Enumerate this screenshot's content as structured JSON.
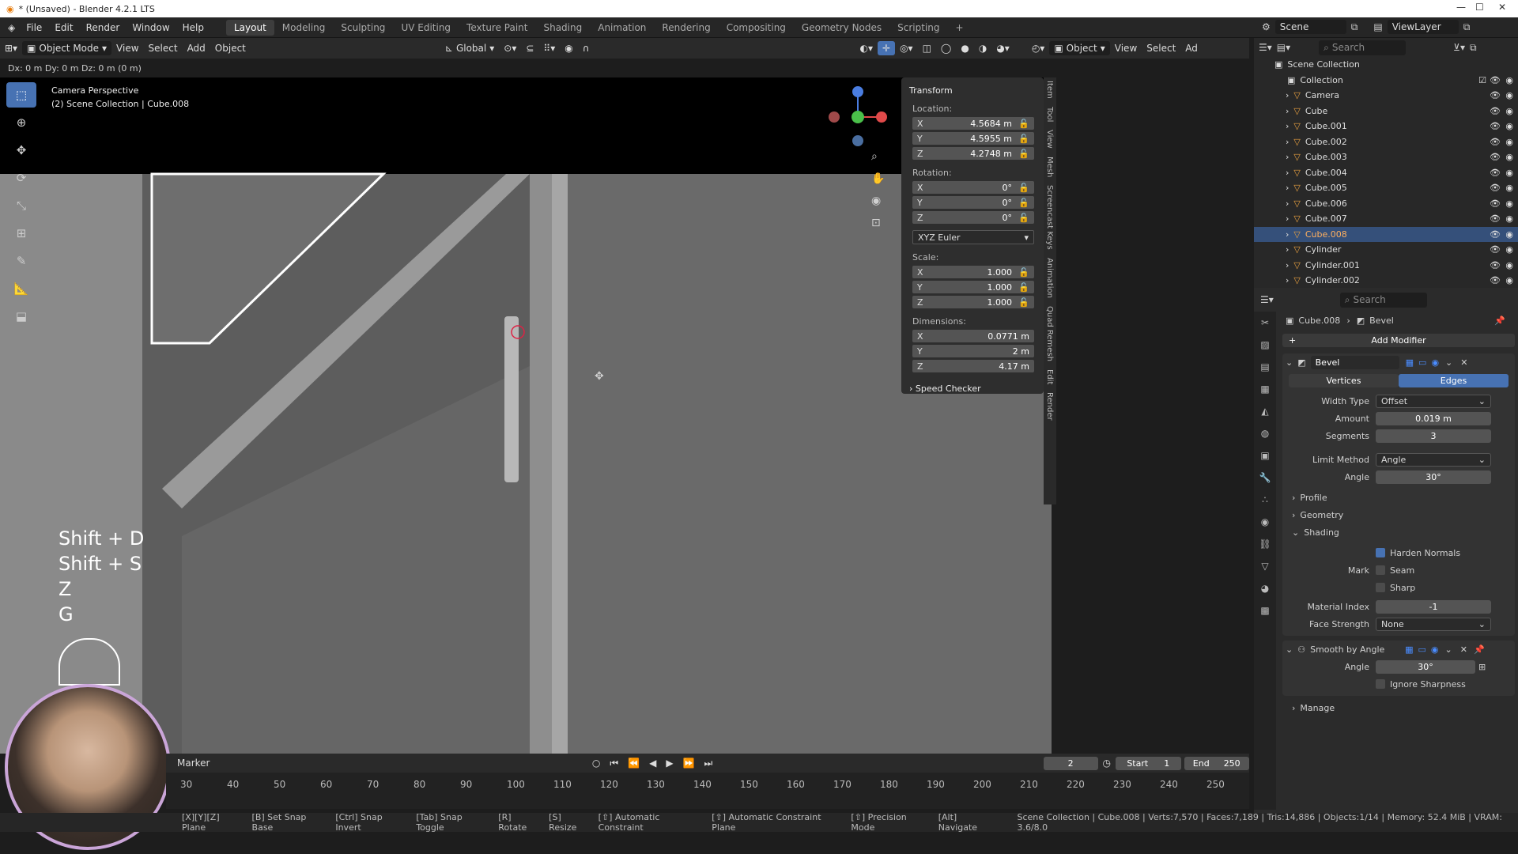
{
  "window": {
    "title": "* (Unsaved) - Blender 4.2.1 LTS"
  },
  "menu": [
    "File",
    "Edit",
    "Render",
    "Window",
    "Help"
  ],
  "workspaces": [
    "Layout",
    "Modeling",
    "Sculpting",
    "UV Editing",
    "Texture Paint",
    "Shading",
    "Animation",
    "Rendering",
    "Compositing",
    "Geometry Nodes",
    "Scripting"
  ],
  "active_workspace": "Layout",
  "scene": {
    "name": "Scene",
    "view_layer": "ViewLayer"
  },
  "header": {
    "mode": "Object Mode",
    "view": "View",
    "select": "Select",
    "add": "Add",
    "object": "Object",
    "orientation": "Global",
    "right_object": "Object",
    "right_view": "View",
    "right_select": "Select",
    "right_ad": "Ad"
  },
  "info": "Dx: 0 m   Dy: 0 m   Dz: 0 m (0 m)",
  "viewport": {
    "line1": "Camera Perspective",
    "line2": "(2) Scene Collection | Cube.008"
  },
  "keys": [
    "Shift + D",
    "Shift + S",
    "Z",
    "G"
  ],
  "transform": {
    "title": "Transform",
    "location_label": "Location:",
    "location": [
      "4.5684 m",
      "4.5955 m",
      "4.2748 m"
    ],
    "rotation_label": "Rotation:",
    "rotation": [
      "0°",
      "0°",
      "0°"
    ],
    "euler": "XYZ Euler",
    "scale_label": "Scale:",
    "scale": [
      "1.000",
      "1.000",
      "1.000"
    ],
    "dimensions_label": "Dimensions:",
    "dimensions": [
      "0.0771 m",
      "2 m",
      "4.17 m"
    ],
    "speed_checker": "Speed Checker",
    "axes": [
      "X",
      "Y",
      "Z"
    ]
  },
  "side_tabs": [
    "Item",
    "Tool",
    "View",
    "Mesh",
    "Screencast Keys",
    "Animation",
    "Quad Remesh",
    "Edit",
    "Render"
  ],
  "timeline": {
    "marker": "Marker",
    "current": "2",
    "start_label": "Start",
    "start": "1",
    "end_label": "End",
    "end": "250",
    "ticks": [
      "30",
      "40",
      "50",
      "60",
      "70",
      "80",
      "90",
      "100",
      "110",
      "120",
      "130",
      "140",
      "150",
      "160",
      "170",
      "180",
      "190",
      "200",
      "210",
      "220",
      "230",
      "240",
      "250"
    ]
  },
  "status": [
    "Plane",
    "Set Snap Base",
    "Snap Invert",
    "Snap Toggle",
    "Rotate",
    "Resize",
    "Automatic Constraint",
    "Automatic Constraint Plane",
    "Precision Mode",
    "Navigate"
  ],
  "status_keys": [
    "X",
    "Y",
    "Z",
    "B",
    "Ctrl",
    "Tab",
    "R",
    "S",
    "⇧",
    "⇧",
    "⇧",
    "Alt"
  ],
  "stats": "Scene Collection | Cube.008 | Verts:7,570 | Faces:7,189 | Tris:14,886 | Objects:1/14 | Memory: 52.4 MiB | VRAM: 3.6/8.0",
  "outliner": {
    "search": "Search",
    "root": "Scene Collection",
    "collection": "Collection",
    "items": [
      "Camera",
      "Cube",
      "Cube.001",
      "Cube.002",
      "Cube.003",
      "Cube.004",
      "Cube.005",
      "Cube.006",
      "Cube.007",
      "Cube.008",
      "Cylinder",
      "Cylinder.001",
      "Cylinder.002"
    ],
    "selected": "Cube.008"
  },
  "properties": {
    "search": "Search",
    "object": "Cube.008",
    "modifier_crumb": "Bevel",
    "add_modifier": "Add Modifier",
    "bevel": {
      "name": "Bevel",
      "tab_vertices": "Vertices",
      "tab_edges": "Edges",
      "width_type_label": "Width Type",
      "width_type": "Offset",
      "amount_label": "Amount",
      "amount": "0.019 m",
      "segments_label": "Segments",
      "segments": "3",
      "limit_label": "Limit Method",
      "limit": "Angle",
      "angle_label": "Angle",
      "angle": "30°",
      "profile": "Profile",
      "geometry": "Geometry",
      "shading": "Shading",
      "harden": "Harden Normals",
      "mark_label": "Mark",
      "seam": "Seam",
      "sharp": "Sharp",
      "matidx_label": "Material Index",
      "matidx": "-1",
      "face_label": "Face Strength",
      "face": "None"
    },
    "smooth": {
      "name": "Smooth by Angle",
      "angle_label": "Angle",
      "angle": "30°",
      "ignore": "Ignore Sharpness"
    },
    "manage": "Manage"
  }
}
